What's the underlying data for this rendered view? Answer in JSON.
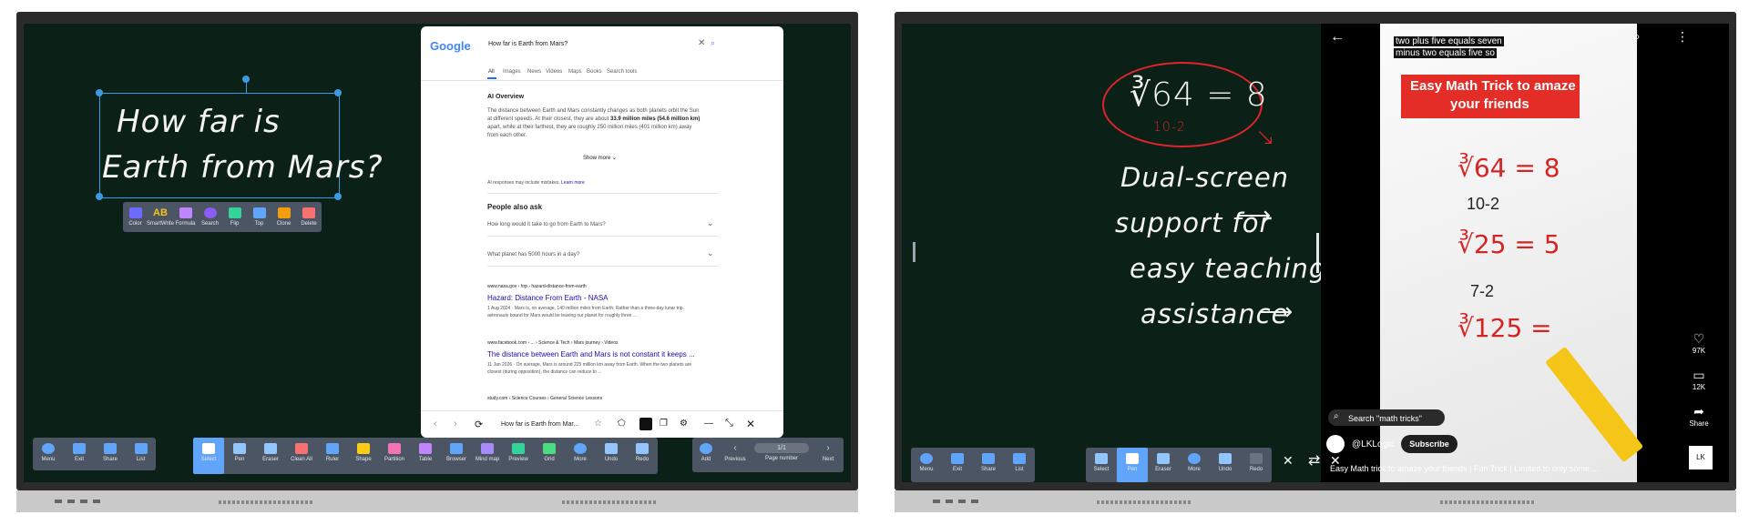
{
  "left": {
    "handwriting": {
      "line1": "How far is",
      "line2": "Earth from Mars?"
    },
    "selection_toolbar": [
      {
        "label": "Color",
        "icon": "color-icon",
        "color": "#6b6bff"
      },
      {
        "label": "SmartWrite",
        "icon": "smartwrite-icon",
        "glyph": "AB",
        "color": "#f5c518"
      },
      {
        "label": "Formula",
        "icon": "formula-icon",
        "color": "#c084fc"
      },
      {
        "label": "Search",
        "icon": "search-icon",
        "color": "#8b5cf6"
      },
      {
        "label": "Flip",
        "icon": "flip-icon",
        "color": "#34d399"
      },
      {
        "label": "Top",
        "icon": "top-icon",
        "color": "#60a5fa"
      },
      {
        "label": "Clone",
        "icon": "clone-icon",
        "color": "#f59e0b"
      },
      {
        "label": "Delete",
        "icon": "delete-icon",
        "color": "#f87171"
      }
    ],
    "google": {
      "logo": "Google",
      "query": "How far is Earth from Mars?",
      "tabs": [
        "All",
        "Images",
        "News",
        "Videos",
        "Maps",
        "Books",
        "Search tools"
      ],
      "ai_overview_title": "AI Overview",
      "ai_text_1": "The distance between Earth and Mars constantly changes as both planets orbit the Sun",
      "ai_text_2a": "at different speeds. At their closest, they are about ",
      "ai_text_2b": "33.9 million miles (54.6 million km)",
      "ai_text_3": "apart, while at their farthest, they are roughly 250 million miles (401 million km) away",
      "ai_text_4": "from each other.",
      "show_more": "Show more",
      "ai_disclaimer": "AI responses may include mistakes.",
      "learn_more": "Learn more",
      "people_also_ask": "People also ask",
      "paa": [
        "How long would it take to go from Earth to Mars?",
        "What planet has 5000 hours in a day?"
      ],
      "results": [
        {
          "source": "www.nasa.gov › hrp › hazard-distance-from-earth",
          "title": "Hazard: Distance From Earth - NASA",
          "snippet1": "1 Aug 2024 · Mars is, on average, 140 million miles from Earth. Rather than a three-day lunar trip,",
          "snippet2": "astronauts bound for Mars would be leaving our planet for roughly three ..."
        },
        {
          "source": "www.facebook.com › ... › Science & Tech › Mars journey › Videos",
          "title": "The distance between Earth and Mars is not constant it keeps ...",
          "snippet1": "11 Jan 2026 · On average, Mars is around 225 million km away from Earth. When the two planets are",
          "snippet2": "closest (during opposition), the distance can reduce to ..."
        },
        {
          "source": "study.com › Science Courses › General Science Lessons",
          "title": "",
          "snippet1": "",
          "snippet2": ""
        }
      ],
      "address_bar": "How far is Earth from Mar...",
      "page_indicator": "1/1"
    },
    "toolbar_left": [
      {
        "label": "Menu",
        "icon": "menu-icon"
      },
      {
        "label": "Exit",
        "icon": "exit-icon"
      },
      {
        "label": "Share",
        "icon": "share-icon"
      },
      {
        "label": "List",
        "icon": "list-icon"
      }
    ],
    "toolbar_main": [
      {
        "label": "Select",
        "icon": "select-icon",
        "active": true
      },
      {
        "label": "Pen",
        "icon": "pen-icon"
      },
      {
        "label": "Eraser",
        "icon": "eraser-icon"
      },
      {
        "label": "Clean All",
        "icon": "clean-all-icon"
      },
      {
        "label": "Ruler",
        "icon": "ruler-icon"
      },
      {
        "label": "Shape",
        "icon": "shape-icon"
      },
      {
        "label": "Partition",
        "icon": "partition-icon"
      },
      {
        "label": "Table",
        "icon": "table-icon"
      },
      {
        "label": "Browser",
        "icon": "browser-icon"
      },
      {
        "label": "Mind map",
        "icon": "mind-map-icon"
      },
      {
        "label": "Preview",
        "icon": "preview-icon"
      },
      {
        "label": "Grid",
        "icon": "grid-icon"
      },
      {
        "label": "More",
        "icon": "more-icon"
      },
      {
        "label": "Undo",
        "icon": "undo-icon"
      },
      {
        "label": "Redo",
        "icon": "redo-icon"
      }
    ],
    "toolbar_right": {
      "add": "Add",
      "previous": "Previous",
      "page": "1/1",
      "page_number": "Page number",
      "next": "Next"
    }
  },
  "right": {
    "handwriting": {
      "formula": "∛64 = 8",
      "note": "10-2",
      "lines": [
        "Dual-screen",
        "support for",
        "easy teaching",
        "assistance"
      ]
    },
    "video": {
      "caption_1": "two plus five equals seven",
      "caption_2": "minus two equals five so",
      "banner_1": "Easy Math Trick to amaze",
      "banner_2": "your friends",
      "paper_eq1": "∛64 = 8",
      "paper_n1": "10-2",
      "paper_eq2": "∛25 = 5",
      "paper_n2": "7-2",
      "paper_eq3": "∛125 =",
      "search_chip": "Search \"math tricks\"",
      "channel": "@LKLogic",
      "subscribe": "Subscribe",
      "description": "Easy Math trick to amaze your friends | Fun Trick | Limited to only some ...",
      "likes": "97K",
      "comments": "12K",
      "share": "Share",
      "avatar": "LK"
    },
    "toolbar_left": [
      {
        "label": "Menu",
        "icon": "menu-icon"
      },
      {
        "label": "Exit",
        "icon": "exit-icon"
      },
      {
        "label": "Share",
        "icon": "share-icon"
      },
      {
        "label": "List",
        "icon": "list-icon"
      }
    ],
    "toolbar_main": [
      {
        "label": "Select",
        "icon": "select-icon"
      },
      {
        "label": "Pen",
        "icon": "pen-icon",
        "active": true
      },
      {
        "label": "Eraser",
        "icon": "eraser-icon"
      },
      {
        "label": "More",
        "icon": "more-icon"
      },
      {
        "label": "Undo",
        "icon": "undo-icon"
      },
      {
        "label": "Redo",
        "icon": "redo-icon"
      }
    ]
  },
  "colors": {
    "board": "#0b2016",
    "toolbar": "#4b5563",
    "accent": "#60a5fa",
    "youtube_red": "#e52d27",
    "google_blue": "#4285f4"
  }
}
